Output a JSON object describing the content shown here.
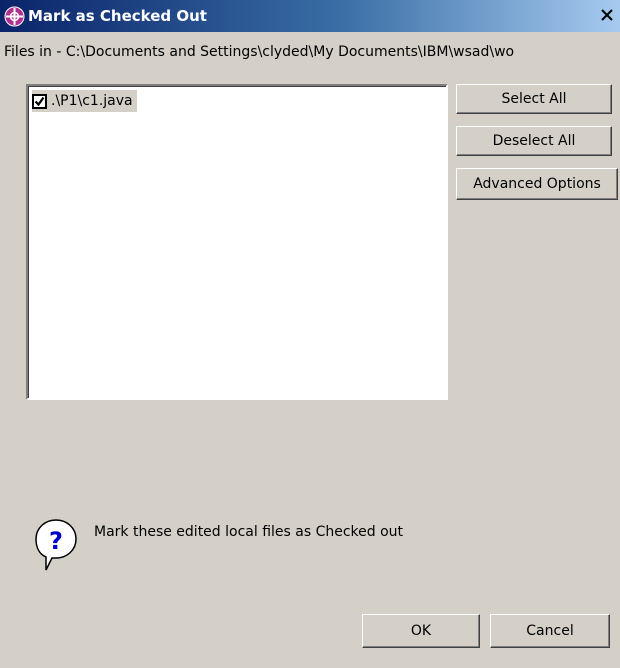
{
  "window": {
    "title": "Mark as Checked Out",
    "close_glyph": "X"
  },
  "path_label": "Files in - C:\\Documents and Settings\\clyded\\My Documents\\IBM\\wsad\\wo",
  "files": [
    {
      "label": ".\\P1\\c1.java",
      "checked": true
    }
  ],
  "buttons": {
    "select_all": "Select All",
    "deselect_all": "Deselect All",
    "advanced_options": "Advanced Options",
    "ok": "OK",
    "cancel": "Cancel"
  },
  "info": {
    "message": "Mark these edited local files as Checked out",
    "icon": "question-balloon-icon"
  },
  "colors": {
    "dialog_bg": "#d4d0c8",
    "titlebar_start": "#0a246a",
    "titlebar_end": "#a6caf0",
    "info_icon_fg": "#0000c8"
  }
}
